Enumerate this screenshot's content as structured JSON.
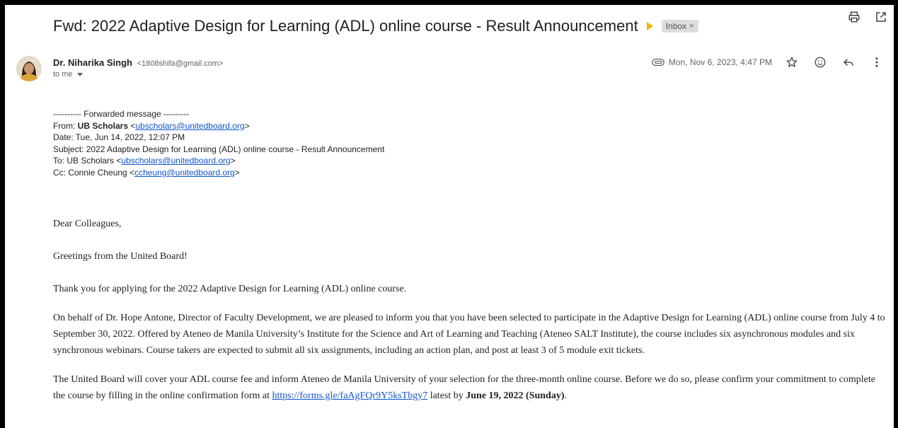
{
  "subject": "Fwd: 2022 Adaptive Design for Learning (ADL) online course - Result Announcement",
  "label_chip": {
    "text": "Inbox",
    "close": "×"
  },
  "icons": {
    "importance": "importance-marker-icon",
    "print": "print-icon",
    "new_window": "open-in-new-window-icon",
    "attachment": "attachment-icon",
    "star": "star-icon",
    "emoji": "emoji-reaction-icon",
    "reply": "reply-icon",
    "more": "more-vert-icon"
  },
  "sender": {
    "name": "Dr. Niharika Singh",
    "email": "<1808shifa@gmail.com>",
    "to": "to me"
  },
  "date": "Mon, Nov 6, 2023, 4:47 PM",
  "forwarded": {
    "divider": "---------- Forwarded message ---------",
    "from_label": "From: ",
    "from_name": "UB Scholars",
    "from_email": "ubscholars@unitedboard.org",
    "date_line": "Date: Tue, Jun 14, 2022, 12:07 PM",
    "subject_line": "Subject: 2022 Adaptive Design for Learning (ADL) online course - Result Announcement",
    "to_label": "To: UB Scholars ",
    "to_email": "ubscholars@unitedboard.org",
    "cc_label": "Cc: Connie Cheung ",
    "cc_email": "ccheung@unitedboard.org"
  },
  "body": {
    "greeting": "Dear Colleagues,",
    "greetings_line": "Greetings from the United Board!",
    "thanks": "Thank you for applying for the 2022 Adaptive Design for Learning (ADL) online course.",
    "para1": "On behalf of Dr. Hope Antone, Director of Faculty Development, we are pleased to inform you that you have been selected to participate in the Adaptive Design for Learning (ADL) online course from July 4 to September 30, 2022. Offered by Ateneo de Manila University’s Institute for the Science and Art of Learning and Teaching (Ateneo SALT Institute), the course includes six asynchronous modules and six synchronous webinars. Course takers are expected to submit all six assignments, including an action plan, and post at least 3 of 5 module exit tickets.",
    "para2_start": "The United Board will cover your ADL course fee and inform Ateneo de Manila University of your selection for the three-month online course. Before we do so, please confirm your commitment to complete the course by filling in the online confirmation form at ",
    "para2_link": "https://forms.gle/faAgFQr9Y5ksTbgy7",
    "para2_mid": " latest by ",
    "para2_deadline": "June 19, 2022 (Sunday)",
    "para2_end": "."
  }
}
